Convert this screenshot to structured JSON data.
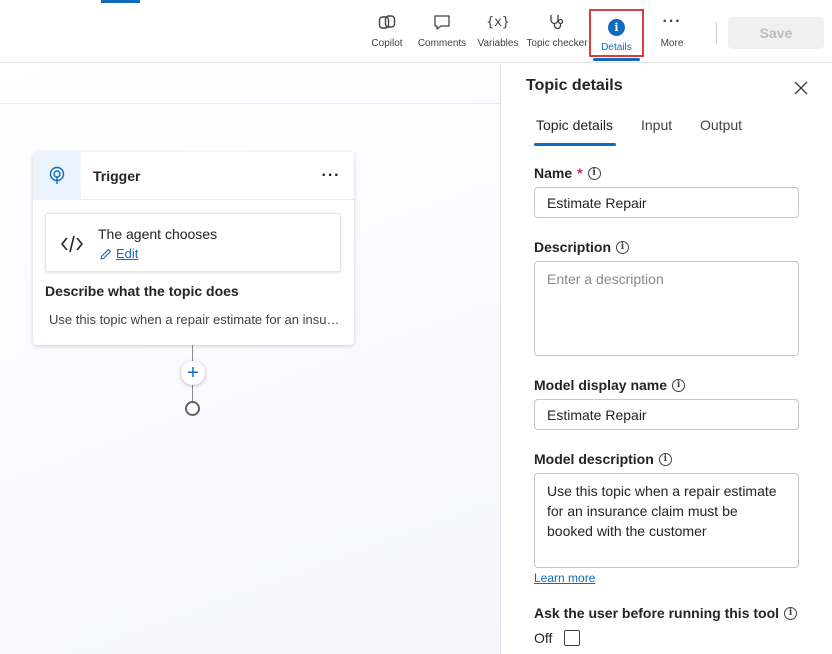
{
  "toolbar": {
    "copilot_label": "Copilot",
    "comments_label": "Comments",
    "variables_label": "Variables",
    "variables_glyph": "{x}",
    "checker_label": "Topic checker",
    "details_label": "Details",
    "details_glyph": "i",
    "more_label": "More",
    "more_glyph": "···",
    "save_label": "Save"
  },
  "canvas": {
    "trigger": {
      "title": "Trigger",
      "menu_glyph": "···",
      "agent_title": "The agent chooses",
      "edit_label": "Edit",
      "desc_label": "Describe what the topic does",
      "desc_text": "Use this topic when a repair estimate for an insurance claim must be booked with the customer"
    },
    "add_glyph": "+"
  },
  "panel": {
    "title": "Topic details",
    "tabs": [
      {
        "label": "Topic details",
        "active": true
      },
      {
        "label": "Input",
        "active": false
      },
      {
        "label": "Output",
        "active": false
      }
    ],
    "name": {
      "label": "Name",
      "required_mark": "*",
      "value": "Estimate Repair"
    },
    "description": {
      "label": "Description",
      "placeholder": "Enter a description"
    },
    "model_display_name": {
      "label": "Model display name",
      "value": "Estimate Repair"
    },
    "model_description": {
      "label": "Model description",
      "value": "Use this topic when a repair estimate for an insurance claim must be booked with the customer"
    },
    "learn_more": "Learn more",
    "ask_user": {
      "label": "Ask the user before running this tool",
      "state": "Off"
    },
    "info_glyph": "i"
  },
  "colors": {
    "accent": "#0f6cbd",
    "highlight_border": "#e0393e",
    "required": "#c4314b"
  }
}
